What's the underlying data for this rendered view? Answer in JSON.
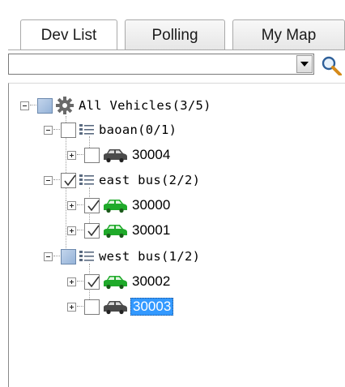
{
  "tabs": [
    {
      "label": "Dev List",
      "active": true
    },
    {
      "label": "Polling",
      "active": false
    },
    {
      "label": "My Map",
      "active": false
    }
  ],
  "search": {
    "value": "",
    "placeholder": ""
  },
  "tree": {
    "root": {
      "label": "All Vehicles(3/5)",
      "checked": "partial",
      "icon": "gear-icon"
    },
    "groups": [
      {
        "label": "baoan(0/1)",
        "checked": false,
        "icon": "list-icon",
        "vehicles": [
          {
            "label": "30004",
            "checked": false,
            "status": "offline",
            "selected": false
          }
        ]
      },
      {
        "label": "east bus(2/2)",
        "checked": true,
        "icon": "list-icon",
        "vehicles": [
          {
            "label": "30000",
            "checked": true,
            "status": "online",
            "selected": false
          },
          {
            "label": "30001",
            "checked": true,
            "status": "online",
            "selected": false
          }
        ]
      },
      {
        "label": "west bus(1/2)",
        "checked": "partial",
        "icon": "list-icon",
        "vehicles": [
          {
            "label": "30002",
            "checked": true,
            "status": "online",
            "selected": false
          },
          {
            "label": "30003",
            "checked": false,
            "status": "offline",
            "selected": true
          }
        ]
      }
    ]
  },
  "colors": {
    "online": "#1faa2a",
    "offline": "#4a4a4a",
    "selection": "#3399ff"
  }
}
